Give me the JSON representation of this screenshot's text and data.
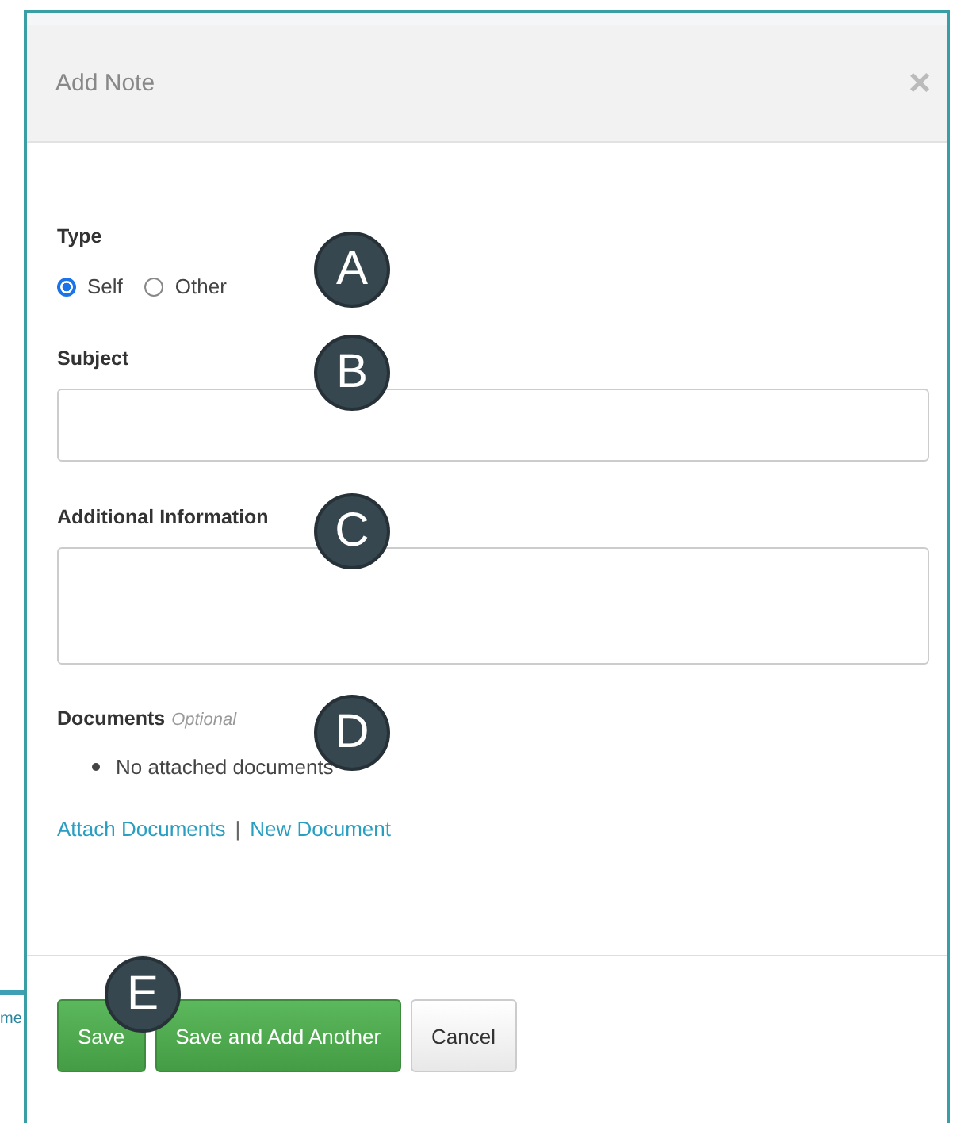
{
  "background_fragment": "me",
  "dialog": {
    "title": "Add Note",
    "close": "×",
    "type_field": {
      "label": "Type",
      "options": [
        {
          "label": "Self",
          "selected": true
        },
        {
          "label": "Other",
          "selected": false
        }
      ]
    },
    "subject": {
      "label": "Subject"
    },
    "additional_information": {
      "label": "Additional Information"
    },
    "documents": {
      "label": "Documents",
      "hint": "Optional",
      "items": [
        "No attached documents"
      ],
      "links": [
        "Attach Documents",
        "New Document"
      ],
      "separator": "|"
    },
    "buttons": [
      {
        "label": "Save",
        "kind": "primary"
      },
      {
        "label": "Save and Add Another",
        "kind": "primary"
      },
      {
        "label": "Cancel",
        "kind": "default"
      }
    ]
  },
  "callouts": [
    "A",
    "B",
    "C",
    "D",
    "E"
  ]
}
